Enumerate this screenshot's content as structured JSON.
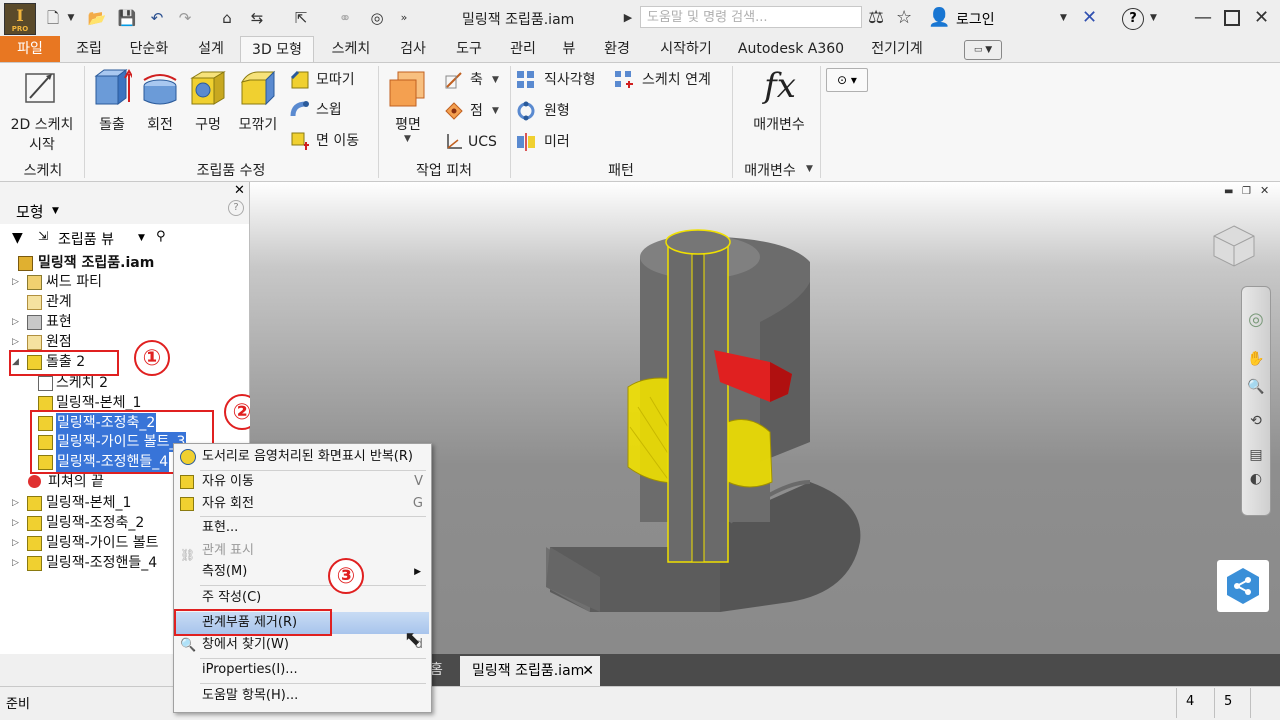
{
  "app": {
    "logo_letter": "I",
    "logo_sub": "PRO",
    "doc_title": "밀링잭 조립품.iam",
    "search_placeholder": "도움말 및 명령 검색...",
    "login_label": "로그인",
    "help_label": "?"
  },
  "tabs": [
    "파일",
    "조립",
    "단순화",
    "설계",
    "3D 모형",
    "스케치",
    "검사",
    "도구",
    "관리",
    "뷰",
    "환경",
    "시작하기",
    "Autodesk A360",
    "전기기계"
  ],
  "ribbon": {
    "sketch_panel": {
      "btn_line1": "2D 스케치",
      "btn_line2": "시작",
      "label": "스케치"
    },
    "modify_panel": {
      "extrude": "돌출",
      "revolve": "회전",
      "hole": "구멍",
      "fillet": "모깎기",
      "chamfer": "모따기",
      "sweep": "스윕",
      "move_face": "면 이동",
      "label": "조립품 수정"
    },
    "work_panel": {
      "plane": "평면",
      "axis": "축",
      "point": "점",
      "ucs": "UCS",
      "label": "작업 피처"
    },
    "pattern_panel": {
      "rect": "직사각형",
      "circular": "원형",
      "mirror": "미러",
      "sketch_link": "스케치 연계",
      "label": "패턴"
    },
    "param_panel": {
      "params": "매개변수",
      "fx": "fx",
      "label": "매개변수"
    }
  },
  "browser": {
    "title": "모형",
    "view_label": "조립품 뷰",
    "root": "밀링잭 조립품.iam",
    "items": [
      "써드 파티",
      "관계",
      "표현",
      "원점",
      "돌출 2",
      "스케치 2",
      "밀링잭-본체_1",
      "밀링잭-조정축_2",
      "밀링잭-가이드 볼트_3",
      "밀링잭-조정핸들_4",
      "피쳐의 끝",
      "밀링잭-본체_1",
      "밀링잭-조정축_2",
      "밀링잭-가이드 볼트",
      "밀링잭-조정핸들_4"
    ]
  },
  "annotations": [
    "①",
    "②",
    "③"
  ],
  "context_menu": {
    "items": [
      {
        "label": "도서리로 음영처리된 화면표시 반복(R)",
        "key": ""
      },
      {
        "label": "자유 이동",
        "key": "V"
      },
      {
        "label": "자유 회전",
        "key": "G"
      },
      {
        "label": "표현...",
        "key": ""
      },
      {
        "label": "관계 표시",
        "key": ""
      },
      {
        "label": "측정(M)",
        "key": ""
      },
      {
        "label": "주 작성(C)",
        "key": ""
      },
      {
        "label": "관계부품 제거(R)",
        "key": ""
      },
      {
        "label": "창에서 찾기(W)",
        "key": "d"
      },
      {
        "label": "iProperties(I)...",
        "key": ""
      },
      {
        "label": "도움말 항목(H)...",
        "key": ""
      }
    ]
  },
  "doc_tabs": {
    "home": "홈",
    "doc": "밀링잭 조립품.iam"
  },
  "status": {
    "text": "준비",
    "n1": "4",
    "n2": "5"
  },
  "colors": {
    "file_tab": "#e87722",
    "selection": "#3874d8",
    "annotation": "#e02020",
    "part_yellow": "#f0e000"
  }
}
